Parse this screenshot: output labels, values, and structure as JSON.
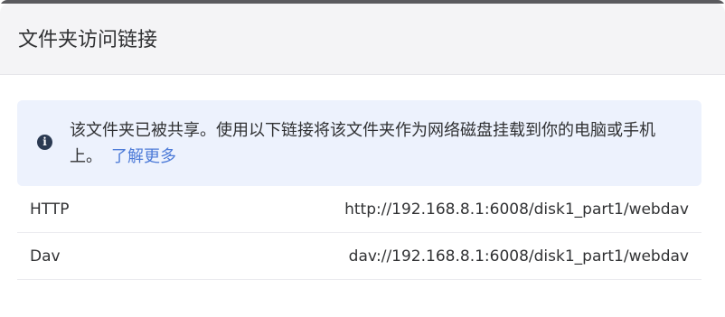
{
  "dialog": {
    "title": "文件夹访问链接"
  },
  "info": {
    "icon": "info-circle-icon",
    "message": "该文件夹已被共享。使用以下链接将该文件夹作为网络磁盘挂载到你的电脑或手机上。",
    "learn_more": "了解更多"
  },
  "links": [
    {
      "label": "HTTP",
      "value": "http://192.168.8.1:6008/disk1_part1/webdav"
    },
    {
      "label": "Dav",
      "value": "dav://192.168.8.1:6008/disk1_part1/webdav"
    }
  ],
  "colors": {
    "header_bg": "#f4f4f6",
    "info_bg": "#edf2fd",
    "link": "#4d7bd8",
    "text": "#303133"
  }
}
